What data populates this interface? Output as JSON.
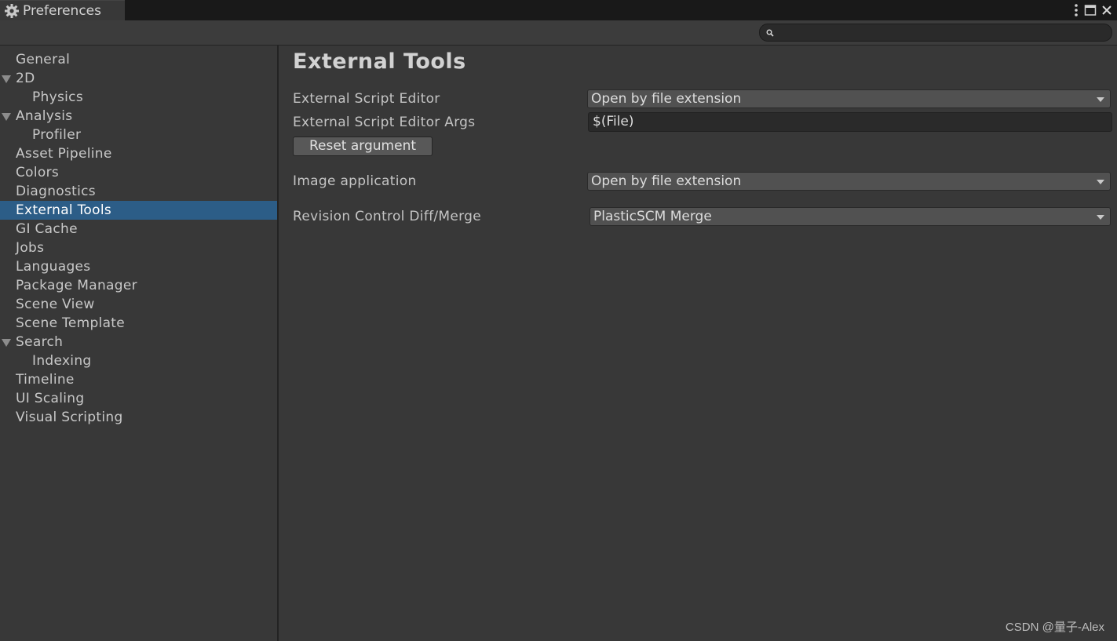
{
  "window": {
    "tab_title": "Preferences",
    "icons": [
      "gear-icon",
      "more-vertical-icon",
      "maximize-icon",
      "close-icon"
    ]
  },
  "search": {
    "placeholder": "",
    "value": ""
  },
  "sidebar": {
    "items": [
      {
        "label": "General",
        "level": 0,
        "foldout": false,
        "selected": false
      },
      {
        "label": "2D",
        "level": 0,
        "foldout": true,
        "selected": false
      },
      {
        "label": "Physics",
        "level": 1,
        "foldout": false,
        "selected": false
      },
      {
        "label": "Analysis",
        "level": 0,
        "foldout": true,
        "selected": false
      },
      {
        "label": "Profiler",
        "level": 1,
        "foldout": false,
        "selected": false
      },
      {
        "label": "Asset Pipeline",
        "level": 0,
        "foldout": false,
        "selected": false
      },
      {
        "label": "Colors",
        "level": 0,
        "foldout": false,
        "selected": false
      },
      {
        "label": "Diagnostics",
        "level": 0,
        "foldout": false,
        "selected": false
      },
      {
        "label": "External Tools",
        "level": 0,
        "foldout": false,
        "selected": true
      },
      {
        "label": "GI Cache",
        "level": 0,
        "foldout": false,
        "selected": false
      },
      {
        "label": "Jobs",
        "level": 0,
        "foldout": false,
        "selected": false
      },
      {
        "label": "Languages",
        "level": 0,
        "foldout": false,
        "selected": false
      },
      {
        "label": "Package Manager",
        "level": 0,
        "foldout": false,
        "selected": false
      },
      {
        "label": "Scene View",
        "level": 0,
        "foldout": false,
        "selected": false
      },
      {
        "label": "Scene Template",
        "level": 0,
        "foldout": false,
        "selected": false
      },
      {
        "label": "Search",
        "level": 0,
        "foldout": true,
        "selected": false
      },
      {
        "label": "Indexing",
        "level": 1,
        "foldout": false,
        "selected": false
      },
      {
        "label": "Timeline",
        "level": 0,
        "foldout": false,
        "selected": false
      },
      {
        "label": "UI Scaling",
        "level": 0,
        "foldout": false,
        "selected": false
      },
      {
        "label": "Visual Scripting",
        "level": 0,
        "foldout": false,
        "selected": false
      }
    ]
  },
  "main": {
    "title": "External Tools",
    "script_editor": {
      "label": "External Script Editor",
      "value": "Open by file extension"
    },
    "script_editor_args": {
      "label": "External Script Editor Args",
      "value": "$(File)"
    },
    "reset_button": "Reset argument",
    "image_application": {
      "label": "Image application",
      "value": "Open by file extension"
    },
    "revision_control": {
      "label": "Revision Control Diff/Merge",
      "value": "PlasticSCM Merge"
    }
  },
  "watermark": "CSDN @量子-Alex",
  "colors": {
    "background": "#383838",
    "titlebar": "#191919",
    "selection": "#2c5d87",
    "dropdown": "#515151",
    "textfield": "#2a2a2a"
  }
}
